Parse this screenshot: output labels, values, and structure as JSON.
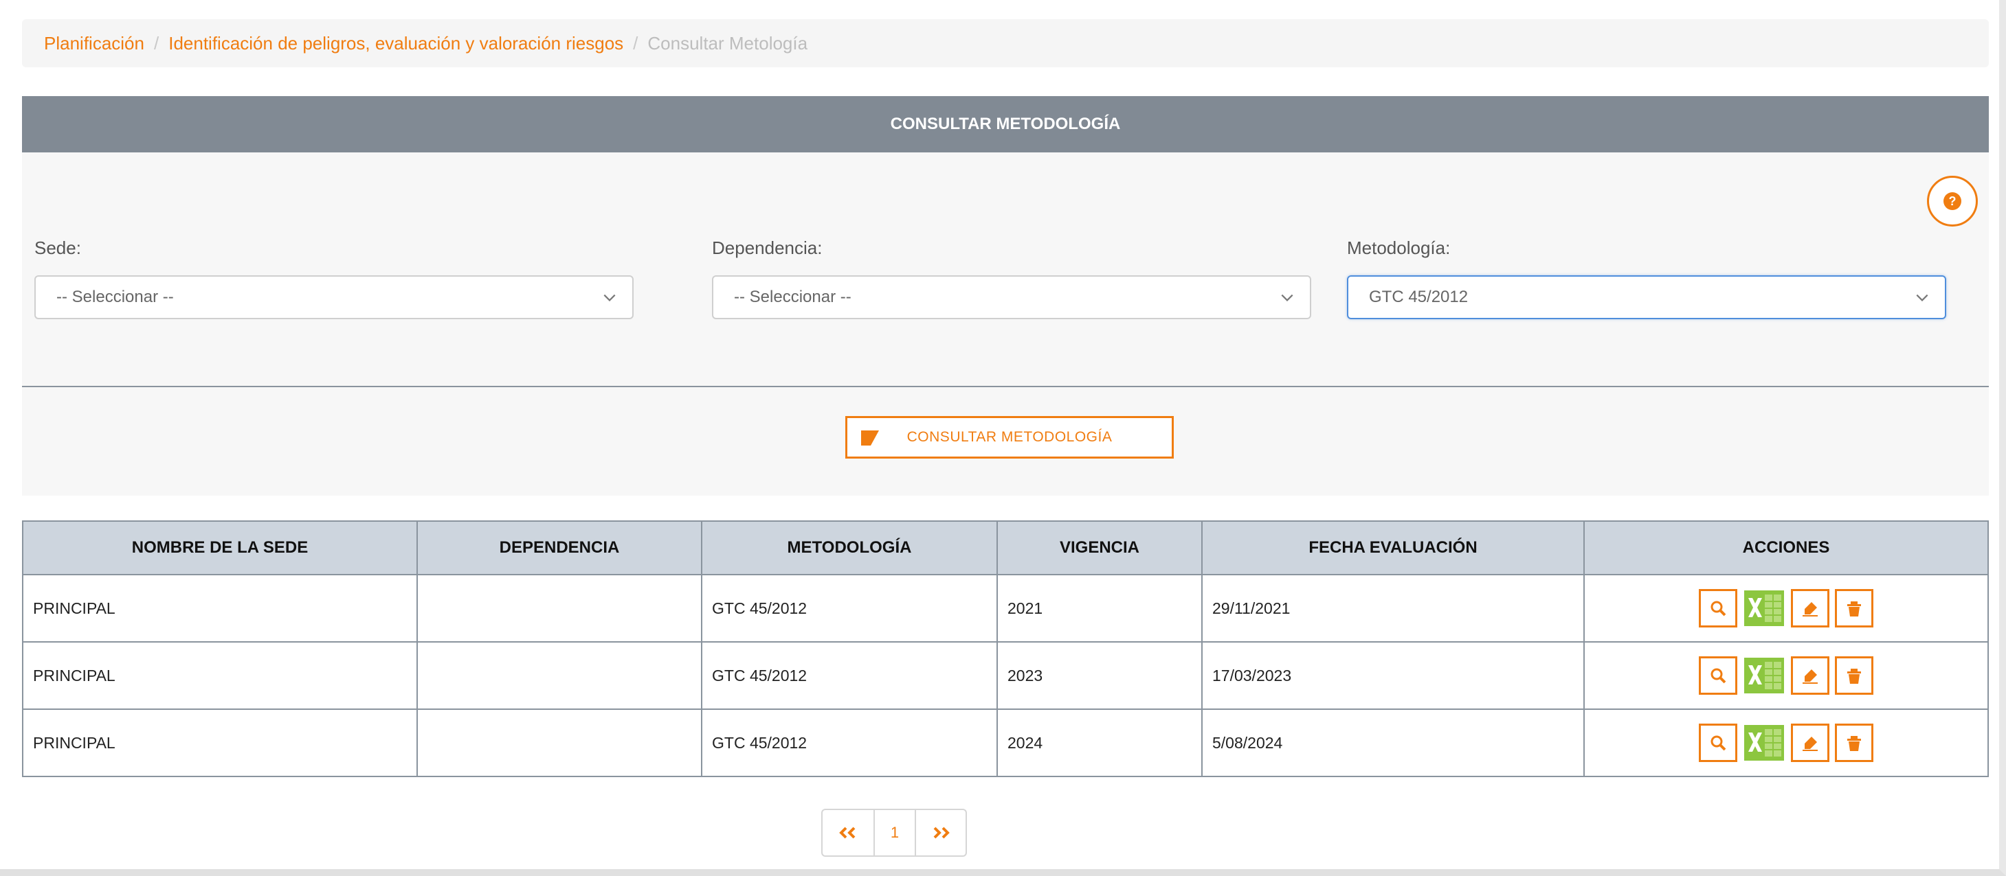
{
  "breadcrumb": {
    "items": [
      "Planificación",
      "Identificación de peligros, evaluación y valoración riesgos"
    ],
    "current": "Consultar Metología",
    "separator": "/"
  },
  "panel": {
    "title": "CONSULTAR METODOLOGÍA",
    "help_icon": "question-circle-icon"
  },
  "filters": {
    "sede": {
      "label": "Sede:",
      "value": "-- Seleccionar --"
    },
    "dependencia": {
      "label": "Dependencia:",
      "value": "-- Seleccionar --"
    },
    "metodologia": {
      "label": "Metodología:",
      "value": "GTC 45/2012"
    }
  },
  "consult_button": {
    "label": "CONSULTAR METODOLOGÍA",
    "icon": "eraser-icon"
  },
  "table": {
    "columns": [
      "NOMBRE DE LA SEDE",
      "DEPENDENCIA",
      "METODOLOGÍA",
      "VIGENCIA",
      "FECHA EVALUACIÓN",
      "ACCIONES"
    ],
    "rows": [
      {
        "sede": "PRINCIPAL",
        "dependencia": "",
        "metodologia": "GTC 45/2012",
        "vigencia": "2021",
        "fecha": "29/11/2021"
      },
      {
        "sede": "PRINCIPAL",
        "dependencia": "",
        "metodologia": "GTC 45/2012",
        "vigencia": "2023",
        "fecha": "17/03/2023"
      },
      {
        "sede": "PRINCIPAL",
        "dependencia": "",
        "metodologia": "GTC 45/2012",
        "vigencia": "2024",
        "fecha": "5/08/2024"
      }
    ],
    "row_actions": [
      "search-icon",
      "excel-icon",
      "edit-icon",
      "delete-icon"
    ]
  },
  "pagination": {
    "prev": "<<",
    "page": "1",
    "next": ">>"
  },
  "colors": {
    "accent": "#f07d11",
    "header": "#818a94",
    "table_header": "#cdd5de",
    "excel": "#7bc142"
  }
}
